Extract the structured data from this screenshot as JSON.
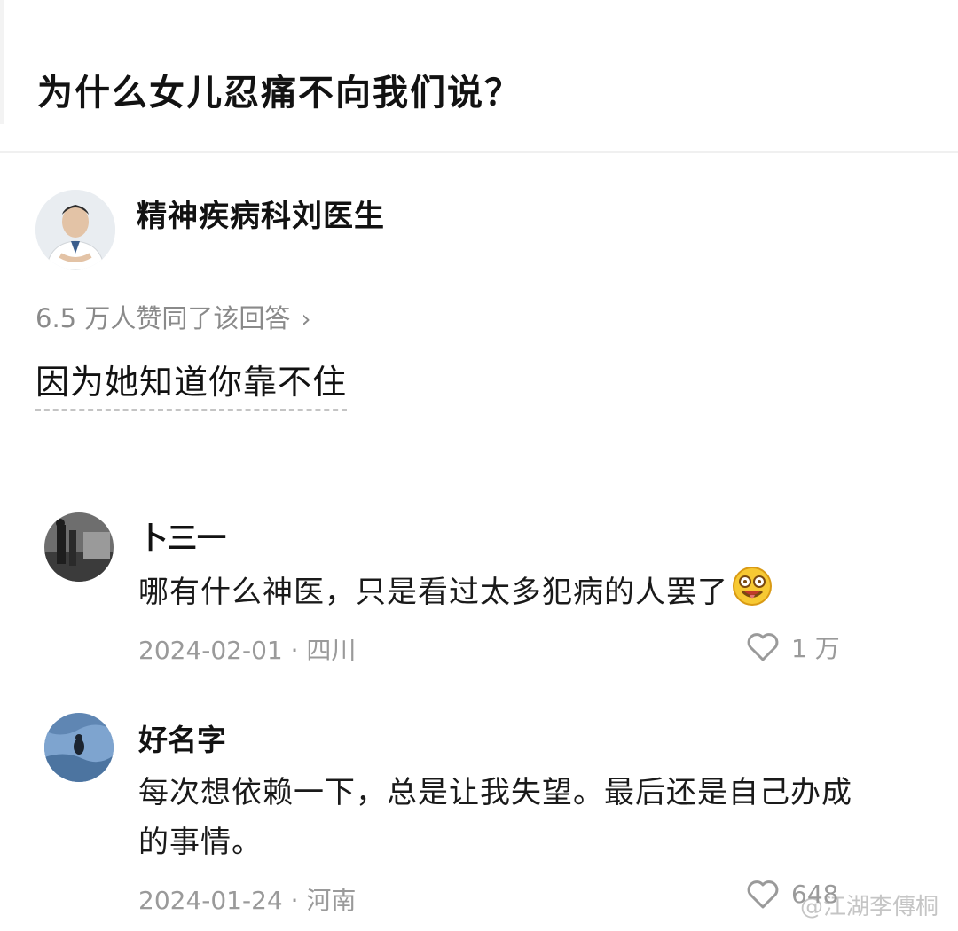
{
  "question": {
    "title": "为什么女儿忍痛不向我们说？"
  },
  "answer": {
    "author_name": "精神疾病科刘医生",
    "upvote_text": "6.5 万人赞同了该回答",
    "body": "因为她知道你靠不住"
  },
  "comments": [
    {
      "user": "卜三一",
      "text": "哪有什么神医，只是看过太多犯病的人罢了",
      "date_location": "2024-02-01 · 四川",
      "likes": "1 万"
    },
    {
      "user": "好名字",
      "text_line1": "每次想依赖一下，总是让我失望。最后还是自己办成",
      "text_line2": "的事情。",
      "date_location": "2024-01-24 · 河南",
      "likes": "648"
    }
  ],
  "watermark": "@江湖李傳桐",
  "icons": {
    "chevron": "chevron-right-icon",
    "like": "heart-icon",
    "emoji": "drooling-face-emoji"
  },
  "colors": {
    "text": "#121212",
    "muted": "#8a8a8a",
    "background": "#ffffff"
  }
}
